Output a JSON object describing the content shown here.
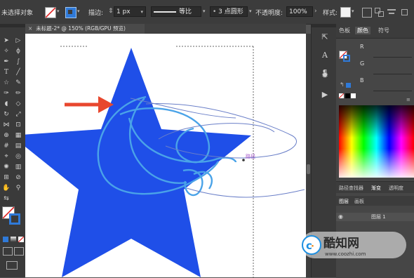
{
  "control_bar": {
    "selection_status": "未选择对象",
    "stroke_label": "描边:",
    "stroke_weight": "1 px",
    "stroke_profile": "等比",
    "brush": "3 点圆形",
    "opacity_label": "不透明度:",
    "opacity_value": "100%",
    "style_label": "样式:"
  },
  "document_tab": {
    "title": "未标题-2* @ 150% (RGB/GPU 预览)",
    "close_glyph": "×"
  },
  "canvas": {
    "star_color": "#1f4fe8",
    "path_color": "#4aa3e8",
    "arrow_color": "#e8472e",
    "anchor_label": "路径"
  },
  "panel": {
    "tabs": [
      "色板",
      "颜色",
      "符号"
    ],
    "active_tab": "颜色",
    "channels": [
      "R",
      "G",
      "B"
    ],
    "bottom_tabs": [
      "路径查找器",
      "渐变",
      "透明度"
    ],
    "layers_tabs": [
      "图层",
      "画板"
    ],
    "layer_name": "图层 1"
  },
  "watermark": {
    "brand": "酷知网",
    "url": "www.coozhi.com"
  },
  "icons": {
    "close": "close-icon",
    "chevron": "chevron-down-icon"
  }
}
